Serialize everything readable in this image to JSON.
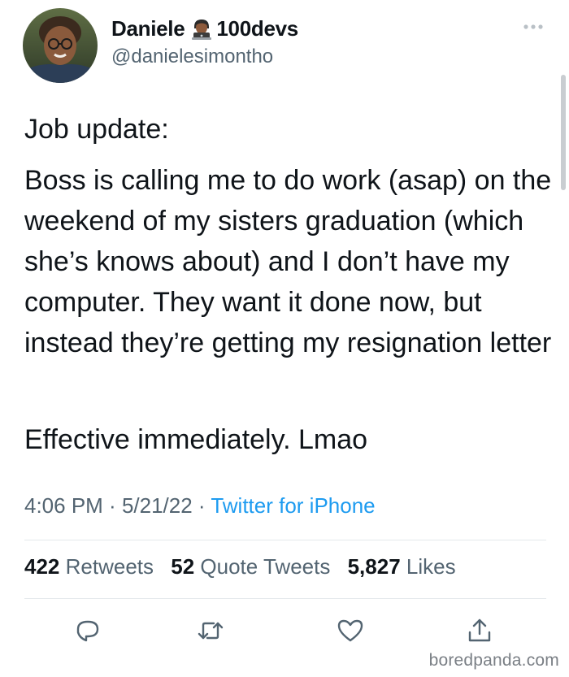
{
  "author": {
    "display_name": "Daniele",
    "name_suffix": "100devs",
    "handle": "@danielesimontho",
    "emoji_icon": "technologist-emoji-icon"
  },
  "tweet": {
    "paragraphs": [
      "Job update:",
      "Boss is calling me to do work (asap) on the weekend of my sisters graduation (which she’s knows about) and I don’t have my computer. They want it done now, but instead they’re getting my resignation letter",
      "Effective immediately. Lmao"
    ],
    "time": "4:06 PM",
    "date": "5/21/22",
    "separator": " · ",
    "source": "Twitter for iPhone"
  },
  "stats": {
    "retweets_count": "422",
    "retweets_label": "Retweets",
    "quotes_count": "52",
    "quotes_label": "Quote Tweets",
    "likes_count": "5,827",
    "likes_label": "Likes"
  },
  "actions": [
    "reply-icon",
    "retweet-icon",
    "like-icon",
    "share-icon"
  ],
  "watermark": "boredpanda.com",
  "colors": {
    "text": "#0f1419",
    "secondary": "#536471",
    "link": "#1d9bf0",
    "divider": "#e4e8eb"
  }
}
